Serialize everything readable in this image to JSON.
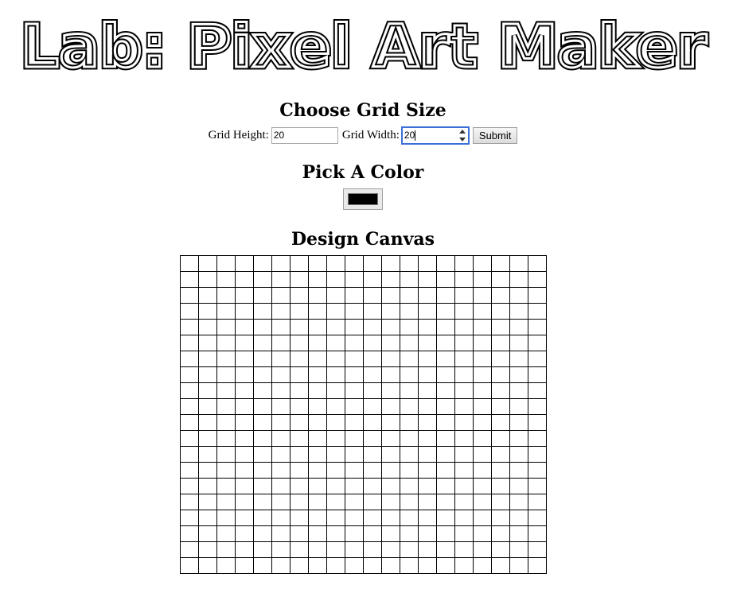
{
  "page_title": "Lab: Pixel Art Maker",
  "grid_section": {
    "heading": "Choose Grid Size",
    "height_label": "Grid Height:",
    "height_value": "20",
    "width_label": "Grid Width:",
    "width_value": "20",
    "submit_label": "Submit"
  },
  "color_section": {
    "heading": "Pick A Color",
    "selected_color": "#000000"
  },
  "canvas_section": {
    "heading": "Design Canvas",
    "rows": 20,
    "columns": 20
  }
}
